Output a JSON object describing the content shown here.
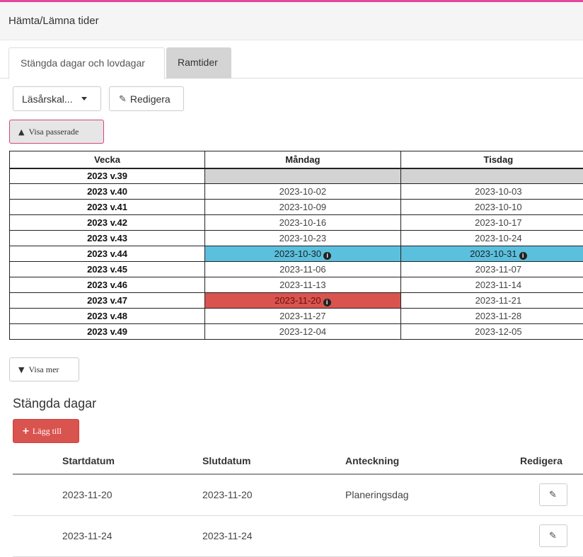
{
  "panel": {
    "title": "Hämta/Lämna tider"
  },
  "tabs": [
    {
      "label": "Stängda dagar och lovdagar",
      "active": true
    },
    {
      "label": "Ramtider",
      "active": false
    }
  ],
  "toolbar": {
    "dropdown_label": "Läsårskal...",
    "edit_label": "Redigera",
    "edit_icon": "edit-icon",
    "show_passed_label": "Visa passerade"
  },
  "week_table": {
    "headers": [
      "Vecka",
      "Måndag",
      "Tisdag"
    ],
    "rows": [
      {
        "week": "2023 v.39",
        "mon": "",
        "tue": ""
      },
      {
        "week": "2023 v.40",
        "mon": "2023-10-02",
        "tue": "2023-10-03"
      },
      {
        "week": "2023 v.41",
        "mon": "2023-10-09",
        "tue": "2023-10-10"
      },
      {
        "week": "2023 v.42",
        "mon": "2023-10-16",
        "tue": "2023-10-17"
      },
      {
        "week": "2023 v.43",
        "mon": "2023-10-23",
        "tue": "2023-10-24"
      },
      {
        "week": "2023 v.44",
        "mon": "2023-10-30",
        "tue": "2023-10-31"
      },
      {
        "week": "2023 v.45",
        "mon": "2023-11-06",
        "tue": "2023-11-07"
      },
      {
        "week": "2023 v.46",
        "mon": "2023-11-13",
        "tue": "2023-11-14"
      },
      {
        "week": "2023 v.47",
        "mon": "2023-11-20",
        "tue": "2023-11-21"
      },
      {
        "week": "2023 v.48",
        "mon": "2023-11-27",
        "tue": "2023-11-28"
      },
      {
        "week": "2023 v.49",
        "mon": "2023-12-04",
        "tue": "2023-12-05"
      }
    ]
  },
  "show_more_label": "Visa mer",
  "closed_days": {
    "title": "Stängda dagar",
    "add_label": "Lägg till",
    "headers": [
      "Startdatum",
      "Slutdatum",
      "Anteckning",
      "Redigera"
    ],
    "rows": [
      {
        "start": "2023-11-20",
        "end": "2023-11-20",
        "note": "Planeringsdag"
      },
      {
        "start": "2023-11-24",
        "end": "2023-11-24",
        "note": ""
      }
    ]
  },
  "colors": {
    "accent_pink": "#e0479e",
    "info_blue": "#5bc0de",
    "danger_red": "#d9534f",
    "empty_gray": "#d3d3d3"
  }
}
